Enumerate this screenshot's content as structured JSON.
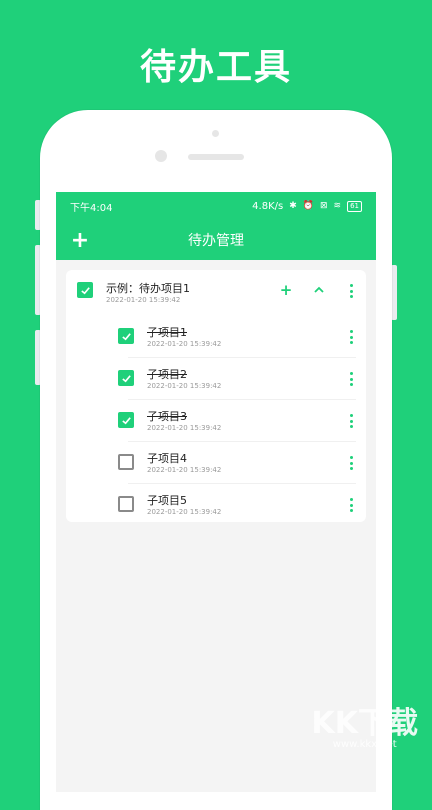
{
  "headline": "待办工具",
  "status_bar": {
    "time": "下午4:04",
    "net_speed": "4.8K/s",
    "battery": "61"
  },
  "app_bar": {
    "title": "待办管理",
    "add_label": "+"
  },
  "task": {
    "title": "示例：待办项目1",
    "time": "2022-01-20 15:39:42",
    "checked": true,
    "add_label": "+",
    "collapse_label": "^",
    "subitems": [
      {
        "title": "子项目1",
        "time": "2022-01-20 15:39:42",
        "checked": true
      },
      {
        "title": "子项目2",
        "time": "2022-01-20 15:39:42",
        "checked": true
      },
      {
        "title": "子项目3",
        "time": "2022-01-20 15:39:42",
        "checked": true
      },
      {
        "title": "子项目4",
        "time": "2022-01-20 15:39:42",
        "checked": false
      },
      {
        "title": "子项目5",
        "time": "2022-01-20 15:39:42",
        "checked": false
      }
    ]
  },
  "watermark": {
    "mark": "KK下载",
    "url": "www.kkx.net"
  },
  "colors": {
    "accent": "#1fd07a",
    "background": "#f4f4f4",
    "card": "#ffffff"
  }
}
